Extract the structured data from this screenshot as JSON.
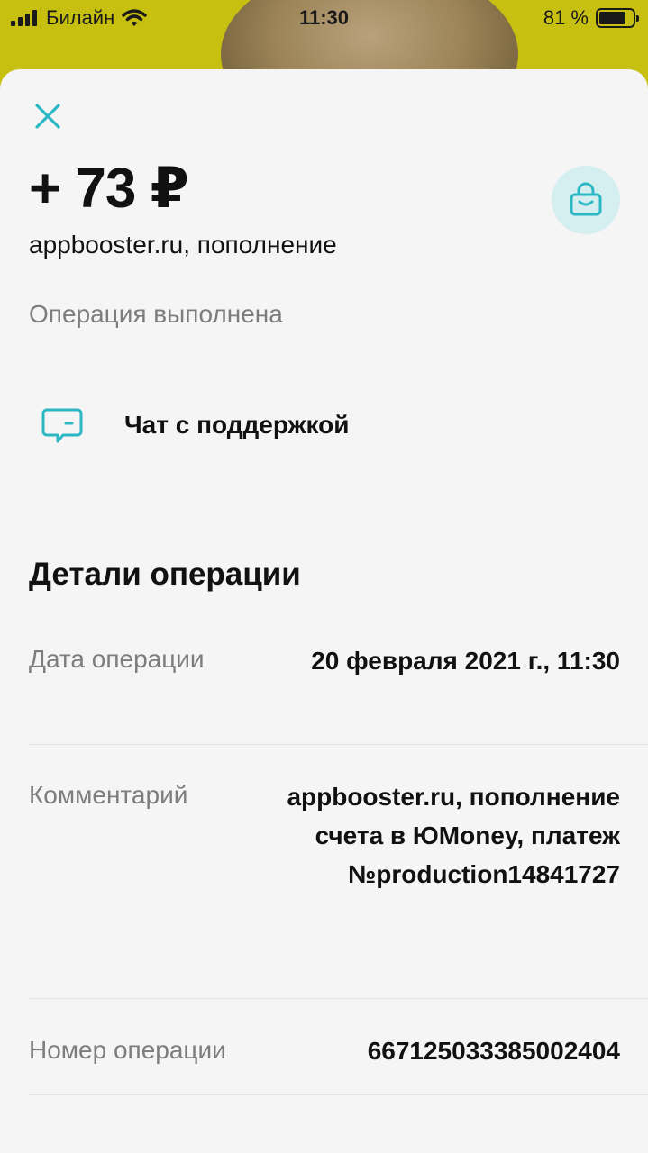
{
  "status_bar": {
    "carrier": "Билайн",
    "time": "11:30",
    "battery_percent": "81 %"
  },
  "transaction": {
    "amount": "+ 73 ₽",
    "merchant": "appbooster.ru, пополнение",
    "status": "Операция выполнена",
    "category_icon": "shopping-bag-icon"
  },
  "actions": {
    "chat_label": "Чат с поддержкой"
  },
  "details": {
    "title": "Детали операции",
    "date_label": "Дата операции",
    "date_value": "20 февраля 2021 г., 11:30",
    "comment_label": "Комментарий",
    "comment_lines": [
      "appbooster.ru, пополнение",
      "счета в ЮMoney, платеж",
      "№production14841727"
    ],
    "op_number_label": "Номер операции",
    "op_number_value": "667125033385002404"
  },
  "colors": {
    "accent": "#2bb8c4",
    "background": "#f5f5f5",
    "icon_bg": "#d5eef0",
    "wallpaper": "#c7c010"
  }
}
